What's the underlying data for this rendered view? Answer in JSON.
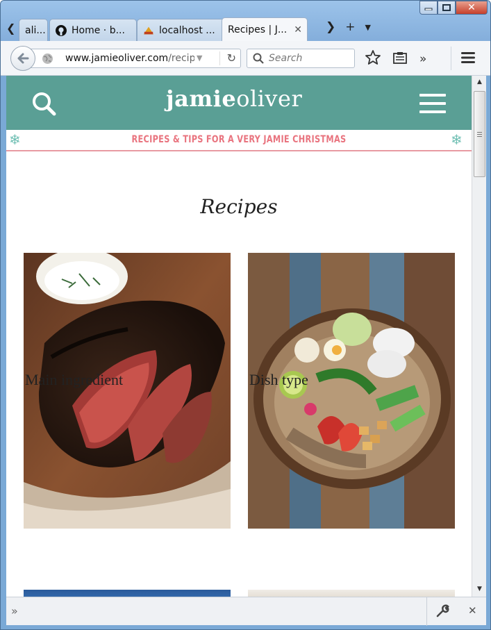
{
  "browser": {
    "tabs": [
      {
        "label": "ali..."
      },
      {
        "label": "Home · b..."
      },
      {
        "label": "localhost ..."
      },
      {
        "label": "Recipes | J..."
      }
    ],
    "url_domain": "www.jamieoliver.com",
    "url_path": "/recip",
    "search_placeholder": "Search"
  },
  "site": {
    "logo_bold": "jamie",
    "logo_light": "oliver",
    "promo": "RECIPES & TIPS FOR A VERY JAMIE CHRISTMAS",
    "page_title": "Recipes",
    "colors": {
      "header": "#5a9f95",
      "promo_text": "#e9747f"
    }
  },
  "cards": [
    {
      "label": "Main ingredient"
    },
    {
      "label": "Dish type"
    }
  ]
}
